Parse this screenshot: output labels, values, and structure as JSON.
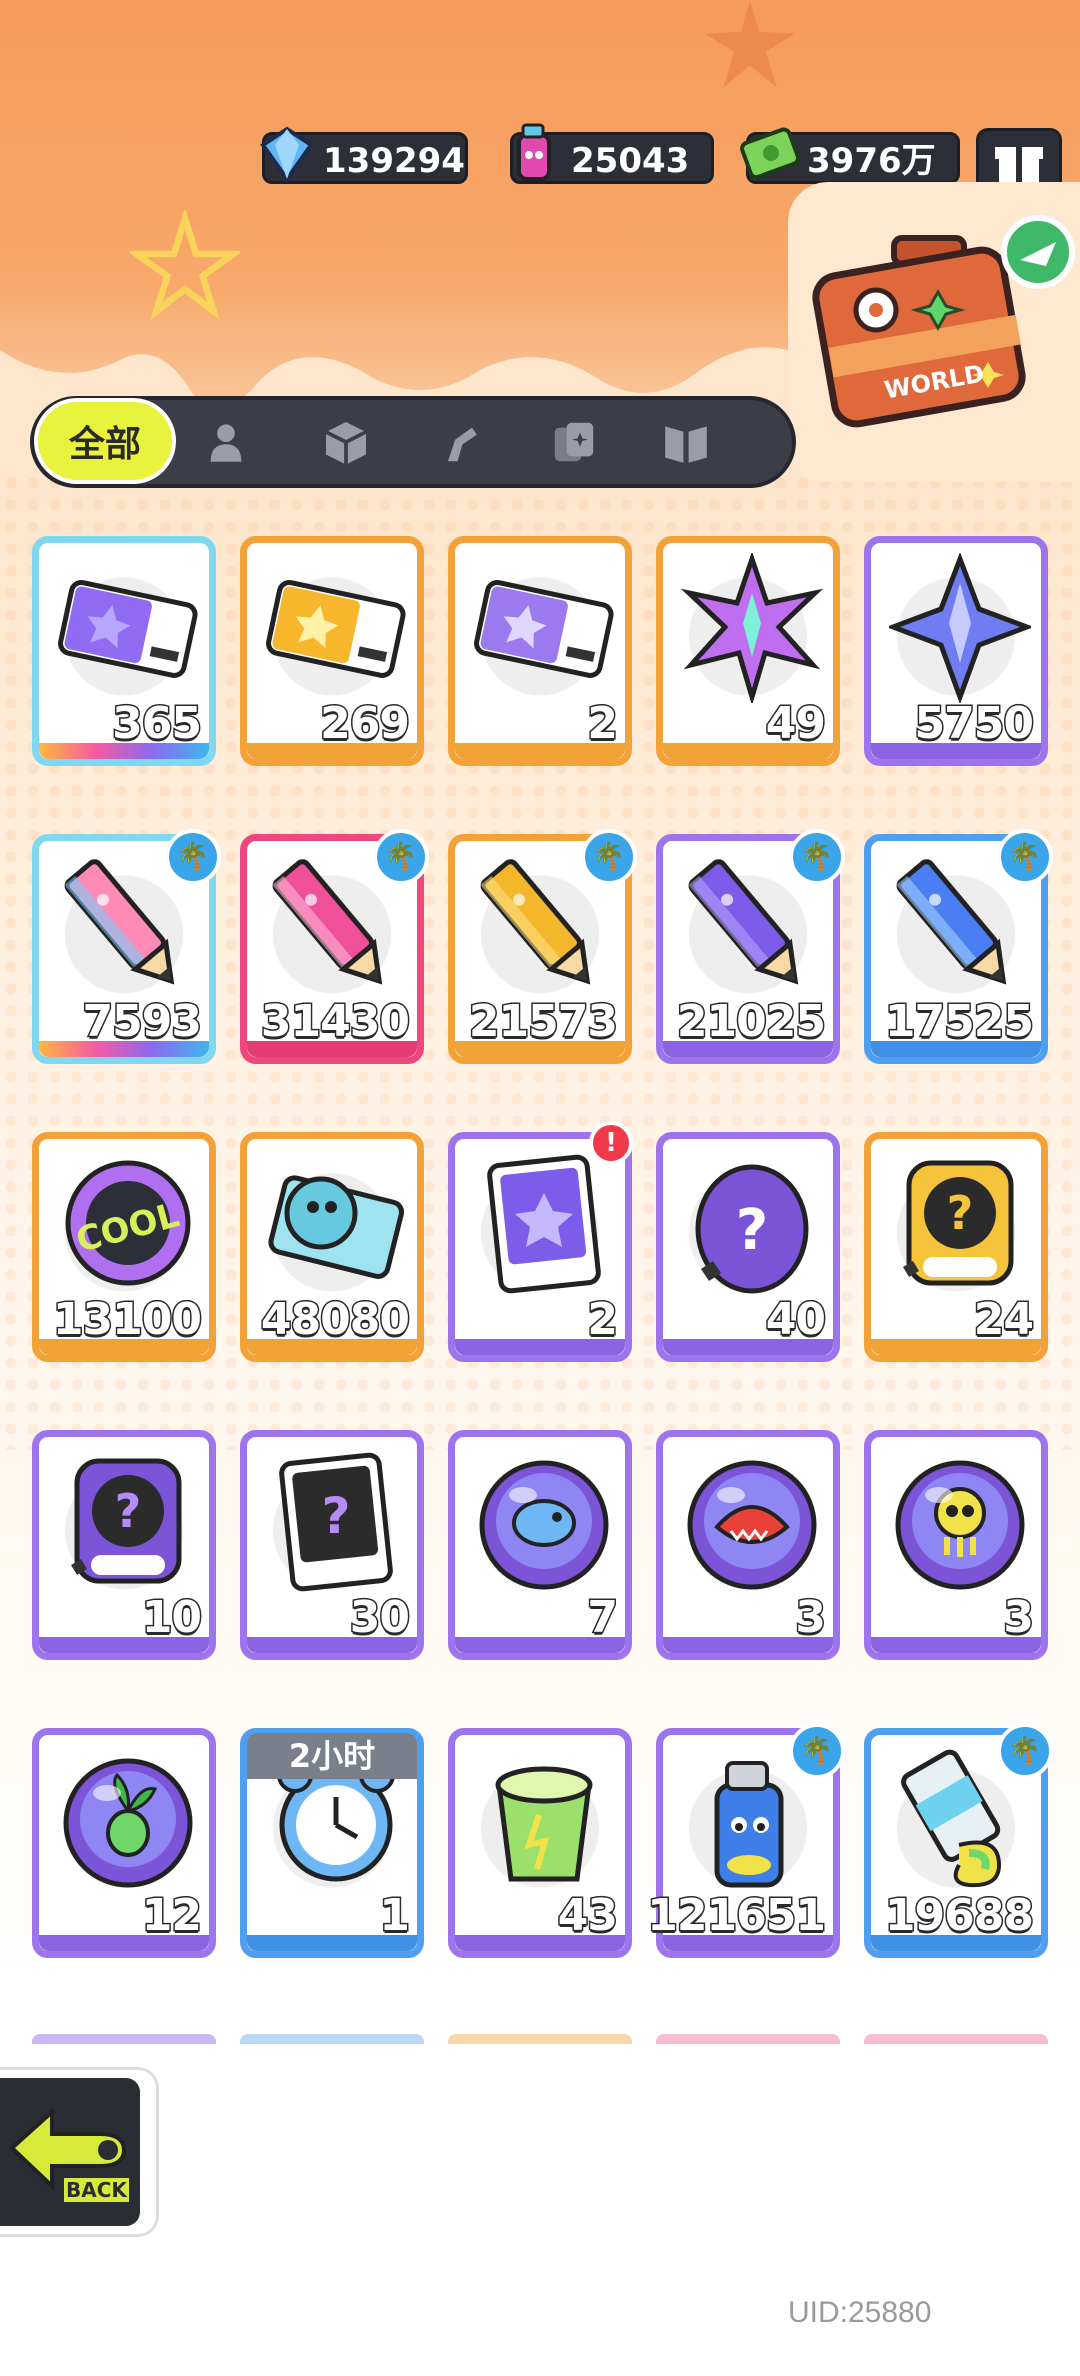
{
  "currencies": [
    {
      "name": "diamond",
      "icon": "diamond-icon",
      "value": "139294"
    },
    {
      "name": "spray",
      "icon": "spray-can-icon",
      "value": "25043"
    },
    {
      "name": "cash",
      "icon": "cash-icon",
      "value": "3976万"
    }
  ],
  "world_button": {
    "label": "WORLD"
  },
  "tabs": [
    {
      "label": "全部",
      "icon": "all",
      "selected": true
    },
    {
      "label": "",
      "icon": "person-icon"
    },
    {
      "label": "",
      "icon": "box-icon"
    },
    {
      "label": "",
      "icon": "spray-gun-icon"
    },
    {
      "label": "",
      "icon": "cards-icon"
    },
    {
      "label": "",
      "icon": "book-icon"
    }
  ],
  "items": [
    {
      "name": "purple-ticket",
      "count": "365",
      "frame": "rainbow"
    },
    {
      "name": "gold-ticket",
      "count": "269",
      "frame": "orange"
    },
    {
      "name": "violet-ticket",
      "count": "2",
      "frame": "orange"
    },
    {
      "name": "rainbow-star",
      "count": "49",
      "frame": "orange"
    },
    {
      "name": "blue-star",
      "count": "5750",
      "frame": "purple"
    },
    {
      "name": "rainbow-pencil",
      "count": "7593",
      "frame": "rainbow",
      "badge": "palm"
    },
    {
      "name": "pink-pencil",
      "count": "31430",
      "frame": "pink",
      "badge": "palm"
    },
    {
      "name": "yellow-pencil",
      "count": "21573",
      "frame": "orange",
      "badge": "palm"
    },
    {
      "name": "purple-pencil",
      "count": "21025",
      "frame": "purple",
      "badge": "palm"
    },
    {
      "name": "blue-pencil",
      "count": "17525",
      "frame": "blue",
      "badge": "palm"
    },
    {
      "name": "cool-badge",
      "count": "13100",
      "frame": "orange"
    },
    {
      "name": "season-ticket",
      "count": "48080",
      "frame": "orange"
    },
    {
      "name": "travel-card",
      "count": "2",
      "frame": "purple",
      "badge": "alert"
    },
    {
      "name": "mystery-egg",
      "count": "40",
      "frame": "purple"
    },
    {
      "name": "deity-mystery-gold",
      "count": "24",
      "frame": "orange"
    },
    {
      "name": "deity-mystery-purple",
      "count": "10",
      "frame": "purple"
    },
    {
      "name": "travel-mystery-card",
      "count": "30",
      "frame": "purple"
    },
    {
      "name": "fish-pet-orb",
      "count": "7",
      "frame": "purple"
    },
    {
      "name": "shark-pet-orb",
      "count": "3",
      "frame": "purple"
    },
    {
      "name": "jelly-pet-orb",
      "count": "3",
      "frame": "purple"
    },
    {
      "name": "plant-pet-orb",
      "count": "12",
      "frame": "purple"
    },
    {
      "name": "alarm-clock",
      "count": "1",
      "frame": "blue",
      "timer": "2小时"
    },
    {
      "name": "open-cup",
      "count": "43",
      "frame": "purple"
    },
    {
      "name": "spray-can",
      "count": "121651",
      "frame": "purple",
      "badge": "palm"
    },
    {
      "name": "paint-tube",
      "count": "19688",
      "frame": "blue",
      "badge": "palm"
    }
  ],
  "alert_mark": "!",
  "palm_mark": "🌴",
  "back_button": {
    "label": "BACK"
  },
  "uid": "UID:25880"
}
